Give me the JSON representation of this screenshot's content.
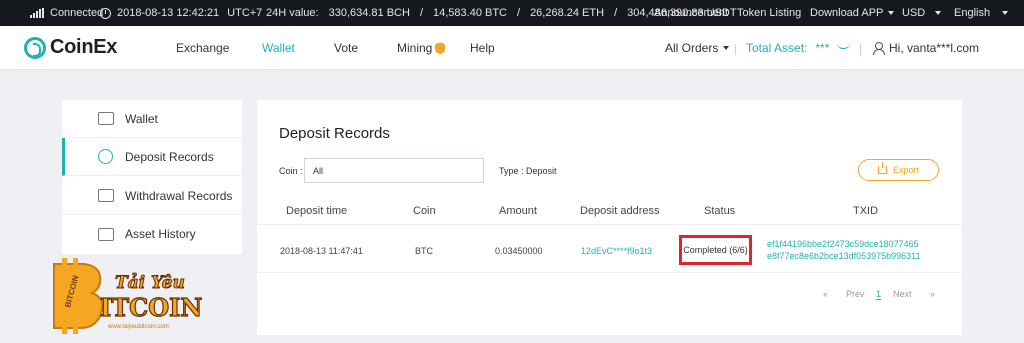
{
  "topbar": {
    "status": "Connected",
    "datetime": "2018-08-13 12:42:21",
    "timezone": "UTC+7",
    "volume_label": "24H value:",
    "bch": "330,634.81 BCH",
    "btc": "14,583.40 BTC",
    "eth": "26,268.24 ETH",
    "usdt": "304,486,390.83 USDT",
    "slash": "/",
    "announcement": "Announcement",
    "token_listing": "Token Listing",
    "download": "Download APP",
    "currency": "USD",
    "language": "English"
  },
  "nav": {
    "logo": "CoinEx",
    "links": [
      "Exchange",
      "Wallet",
      "Vote",
      "Mining",
      "Help"
    ],
    "active": "Wallet",
    "all_orders": "All Orders",
    "total_asset_label": "Total Asset:",
    "total_asset_value": "***",
    "user": "Hi, vanta***l.com"
  },
  "sidebar": {
    "items": [
      {
        "label": "Wallet",
        "icon": "wallet-icon"
      },
      {
        "label": "Deposit Records",
        "icon": "deposit-icon"
      },
      {
        "label": "Withdrawal Records",
        "icon": "withdrawal-icon"
      },
      {
        "label": "Asset History",
        "icon": "asset-history-icon"
      }
    ],
    "active": "Deposit Records"
  },
  "main": {
    "title": "Deposit Records",
    "coin_label": "Coin :",
    "coin_value": "All",
    "type_label": "Type : Deposit",
    "export_label": "Export",
    "columns": [
      "Deposit time",
      "Coin",
      "Amount",
      "Deposit address",
      "Status",
      "TXID"
    ],
    "rows": [
      {
        "time": "2018-08-13 11:47:41",
        "coin": "BTC",
        "amount": "0.03450000",
        "address": "12dEvC****f9o1t3",
        "status": "Completed (6/6)",
        "txid_1": "ef1f44196bbe2f2473c59dce18077465",
        "txid_2": "e8f77ec8e6b2bce13df053975b996311"
      }
    ],
    "pagination": {
      "first": "«",
      "prev": "Prev",
      "page": "1",
      "next": "Next",
      "last": "»"
    }
  },
  "watermark": {
    "line1": "Tải Yêu",
    "line2": "ITCOIN",
    "ribbon": "BITCOIN",
    "url": "www.taiyeubitcoin.com"
  },
  "colors": {
    "accent": "#22b1b9",
    "export": "#f5a623",
    "highlight": "#e0242b",
    "topbar": "#15181d"
  }
}
